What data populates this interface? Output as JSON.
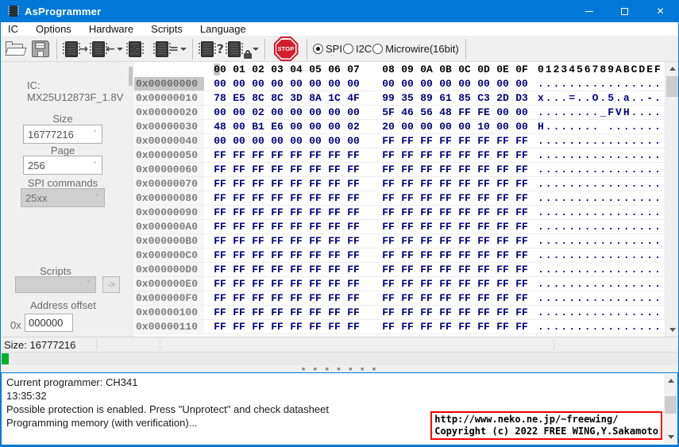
{
  "window": {
    "title": "AsProgrammer",
    "close_glyph": "✕"
  },
  "menu": {
    "items": [
      "IC",
      "Options",
      "Hardware",
      "Scripts",
      "Language"
    ]
  },
  "toolbar": {
    "stop_label": "STOP",
    "verify_glyph": "=",
    "read_glyph": "→",
    "write_glyph": "←",
    "erase_glyph": "✕",
    "detect_glyph": "?",
    "radios": [
      {
        "label": "SPI",
        "selected": true
      },
      {
        "label": "I2C",
        "selected": false
      },
      {
        "label": "Microwire(16bit)",
        "selected": false
      }
    ]
  },
  "sidebar": {
    "ic_label": "IC:",
    "ic_value": "MX25U12873F_1.8V",
    "size_label": "Size",
    "size_value": "16777216",
    "page_label": "Page",
    "page_value": "256",
    "spi_commands_label": "SPI commands",
    "spi_commands_value": "25xx",
    "scripts_label": "Scripts",
    "scripts_value": "",
    "run_script_label": "->",
    "address_offset_label": "Address offset",
    "address_prefix": "0x",
    "address_value": "000000"
  },
  "hex": {
    "byte_headers": [
      "00",
      "01",
      "02",
      "03",
      "04",
      "05",
      "06",
      "07",
      "08",
      "09",
      "0A",
      "0B",
      "0C",
      "0D",
      "0E",
      "0F"
    ],
    "ascii_header": "0123456789ABCDEF",
    "selected_row": 0,
    "rows": [
      {
        "addr": "0x00000000",
        "bytes": [
          "00",
          "00",
          "00",
          "00",
          "00",
          "00",
          "00",
          "00",
          "00",
          "00",
          "00",
          "00",
          "00",
          "00",
          "00",
          "00"
        ],
        "ascii": "................"
      },
      {
        "addr": "0x00000010",
        "bytes": [
          "78",
          "E5",
          "8C",
          "8C",
          "3D",
          "8A",
          "1C",
          "4F",
          "99",
          "35",
          "89",
          "61",
          "85",
          "C3",
          "2D",
          "D3"
        ],
        "ascii": "x...=..O.5.a..-."
      },
      {
        "addr": "0x00000020",
        "bytes": [
          "00",
          "00",
          "02",
          "00",
          "00",
          "00",
          "00",
          "00",
          "5F",
          "46",
          "56",
          "48",
          "FF",
          "FE",
          "00",
          "00"
        ],
        "ascii": "........_FVH...."
      },
      {
        "addr": "0x00000030",
        "bytes": [
          "48",
          "00",
          "B1",
          "E6",
          "00",
          "00",
          "00",
          "02",
          "20",
          "00",
          "00",
          "00",
          "00",
          "10",
          "00",
          "00"
        ],
        "ascii": "H....... ......."
      },
      {
        "addr": "0x00000040",
        "bytes": [
          "00",
          "00",
          "00",
          "00",
          "00",
          "00",
          "00",
          "00",
          "FF",
          "FF",
          "FF",
          "FF",
          "FF",
          "FF",
          "FF",
          "FF"
        ],
        "ascii": "................"
      },
      {
        "addr": "0x00000050",
        "bytes": [
          "FF",
          "FF",
          "FF",
          "FF",
          "FF",
          "FF",
          "FF",
          "FF",
          "FF",
          "FF",
          "FF",
          "FF",
          "FF",
          "FF",
          "FF",
          "FF"
        ],
        "ascii": "................"
      },
      {
        "addr": "0x00000060",
        "bytes": [
          "FF",
          "FF",
          "FF",
          "FF",
          "FF",
          "FF",
          "FF",
          "FF",
          "FF",
          "FF",
          "FF",
          "FF",
          "FF",
          "FF",
          "FF",
          "FF"
        ],
        "ascii": "................"
      },
      {
        "addr": "0x00000070",
        "bytes": [
          "FF",
          "FF",
          "FF",
          "FF",
          "FF",
          "FF",
          "FF",
          "FF",
          "FF",
          "FF",
          "FF",
          "FF",
          "FF",
          "FF",
          "FF",
          "FF"
        ],
        "ascii": "................"
      },
      {
        "addr": "0x00000080",
        "bytes": [
          "FF",
          "FF",
          "FF",
          "FF",
          "FF",
          "FF",
          "FF",
          "FF",
          "FF",
          "FF",
          "FF",
          "FF",
          "FF",
          "FF",
          "FF",
          "FF"
        ],
        "ascii": "................"
      },
      {
        "addr": "0x00000090",
        "bytes": [
          "FF",
          "FF",
          "FF",
          "FF",
          "FF",
          "FF",
          "FF",
          "FF",
          "FF",
          "FF",
          "FF",
          "FF",
          "FF",
          "FF",
          "FF",
          "FF"
        ],
        "ascii": "................"
      },
      {
        "addr": "0x000000A0",
        "bytes": [
          "FF",
          "FF",
          "FF",
          "FF",
          "FF",
          "FF",
          "FF",
          "FF",
          "FF",
          "FF",
          "FF",
          "FF",
          "FF",
          "FF",
          "FF",
          "FF"
        ],
        "ascii": "................"
      },
      {
        "addr": "0x000000B0",
        "bytes": [
          "FF",
          "FF",
          "FF",
          "FF",
          "FF",
          "FF",
          "FF",
          "FF",
          "FF",
          "FF",
          "FF",
          "FF",
          "FF",
          "FF",
          "FF",
          "FF"
        ],
        "ascii": "................"
      },
      {
        "addr": "0x000000C0",
        "bytes": [
          "FF",
          "FF",
          "FF",
          "FF",
          "FF",
          "FF",
          "FF",
          "FF",
          "FF",
          "FF",
          "FF",
          "FF",
          "FF",
          "FF",
          "FF",
          "FF"
        ],
        "ascii": "................"
      },
      {
        "addr": "0x000000D0",
        "bytes": [
          "FF",
          "FF",
          "FF",
          "FF",
          "FF",
          "FF",
          "FF",
          "FF",
          "FF",
          "FF",
          "FF",
          "FF",
          "FF",
          "FF",
          "FF",
          "FF"
        ],
        "ascii": "................"
      },
      {
        "addr": "0x000000E0",
        "bytes": [
          "FF",
          "FF",
          "FF",
          "FF",
          "FF",
          "FF",
          "FF",
          "FF",
          "FF",
          "FF",
          "FF",
          "FF",
          "FF",
          "FF",
          "FF",
          "FF"
        ],
        "ascii": "................"
      },
      {
        "addr": "0x000000F0",
        "bytes": [
          "FF",
          "FF",
          "FF",
          "FF",
          "FF",
          "FF",
          "FF",
          "FF",
          "FF",
          "FF",
          "FF",
          "FF",
          "FF",
          "FF",
          "FF",
          "FF"
        ],
        "ascii": "................"
      },
      {
        "addr": "0x00000100",
        "bytes": [
          "FF",
          "FF",
          "FF",
          "FF",
          "FF",
          "FF",
          "FF",
          "FF",
          "FF",
          "FF",
          "FF",
          "FF",
          "FF",
          "FF",
          "FF",
          "FF"
        ],
        "ascii": "................"
      },
      {
        "addr": "0x00000110",
        "bytes": [
          "FF",
          "FF",
          "FF",
          "FF",
          "FF",
          "FF",
          "FF",
          "FF",
          "FF",
          "FF",
          "FF",
          "FF",
          "FF",
          "FF",
          "FF",
          "FF"
        ],
        "ascii": "................"
      }
    ]
  },
  "statusbar": {
    "size_text": "Size: 16777216"
  },
  "log": {
    "lines": [
      "Current programmer: CH341",
      "13:35:32",
      "Possible protection is enabled. Press \"Unprotect\" and check datasheet",
      "Programming memory (with verification)..."
    ]
  },
  "overlay": {
    "line1": "http://www.neko.ne.jp/~freewing/",
    "line2": "Copyright (c) 2022 FREE WING,Y.Sakamoto"
  },
  "colors": {
    "titlebar": "#0078d7",
    "hex_bytes": "#000080",
    "progress_green": "#06b025",
    "overlay_border": "#ff0000",
    "log_border": "#0078d7"
  }
}
